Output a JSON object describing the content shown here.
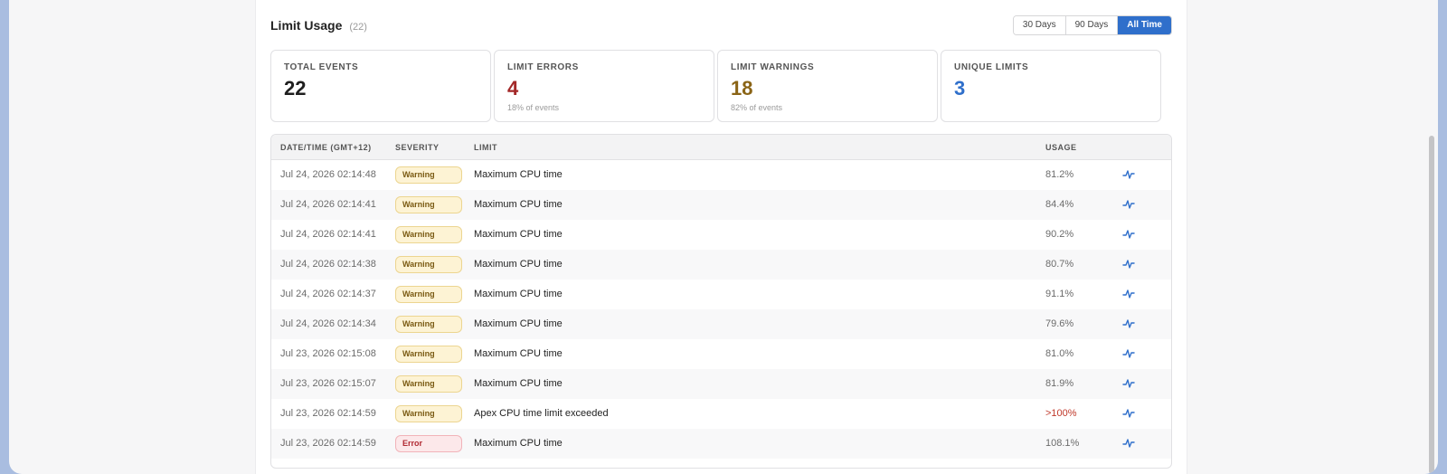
{
  "header": {
    "title": "Limit Usage",
    "count": "(22)",
    "ranges": [
      "30 Days",
      "90 Days",
      "All Time"
    ],
    "active_range": "All Time"
  },
  "cards": [
    {
      "label": "TOTAL EVENTS",
      "value": "22",
      "sub": "",
      "color": "#1f1f1f"
    },
    {
      "label": "LIMIT ERRORS",
      "value": "4",
      "sub": "18% of events",
      "color": "#a32828"
    },
    {
      "label": "LIMIT WARNINGS",
      "value": "18",
      "sub": "82% of events",
      "color": "#8a6416"
    },
    {
      "label": "UNIQUE LIMITS",
      "value": "3",
      "sub": "",
      "color": "#2f6fcb"
    }
  ],
  "table": {
    "columns": [
      "DATE/TIME (GMT+12)",
      "SEVERITY",
      "LIMIT",
      "USAGE"
    ],
    "rows": [
      {
        "datetime": "Jul 24, 2026 02:14:48",
        "severity": "Warning",
        "limit": "Maximum CPU time",
        "usage": "81.2%"
      },
      {
        "datetime": "Jul 24, 2026 02:14:41",
        "severity": "Warning",
        "limit": "Maximum CPU time",
        "usage": "84.4%"
      },
      {
        "datetime": "Jul 24, 2026 02:14:41",
        "severity": "Warning",
        "limit": "Maximum CPU time",
        "usage": "90.2%"
      },
      {
        "datetime": "Jul 24, 2026 02:14:38",
        "severity": "Warning",
        "limit": "Maximum CPU time",
        "usage": "80.7%"
      },
      {
        "datetime": "Jul 24, 2026 02:14:37",
        "severity": "Warning",
        "limit": "Maximum CPU time",
        "usage": "91.1%"
      },
      {
        "datetime": "Jul 24, 2026 02:14:34",
        "severity": "Warning",
        "limit": "Maximum CPU time",
        "usage": "79.6%"
      },
      {
        "datetime": "Jul 23, 2026 02:15:08",
        "severity": "Warning",
        "limit": "Maximum CPU time",
        "usage": "81.0%"
      },
      {
        "datetime": "Jul 23, 2026 02:15:07",
        "severity": "Warning",
        "limit": "Maximum CPU time",
        "usage": "81.9%"
      },
      {
        "datetime": "Jul 23, 2026 02:14:59",
        "severity": "Warning",
        "limit": "Apex CPU time limit exceeded",
        "usage": ">100%"
      },
      {
        "datetime": "Jul 23, 2026 02:14:59",
        "severity": "Error",
        "limit": "Maximum CPU time",
        "usage": "108.1%"
      }
    ],
    "row_icon": "activity-chart-icon",
    "icon_color": "#2f6fcb",
    "over_limit_color": "#c0392b"
  }
}
